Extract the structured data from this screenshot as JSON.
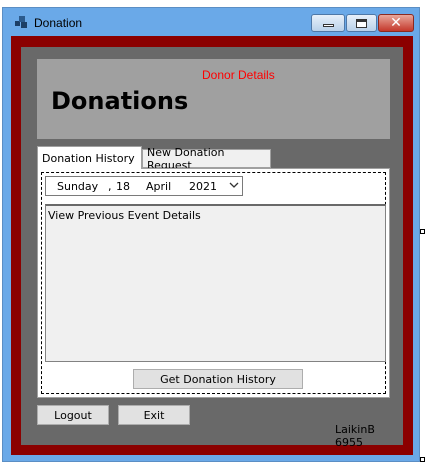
{
  "window": {
    "title": "Donation"
  },
  "header": {
    "subtitle": "Donor Details",
    "title": "Donations"
  },
  "tabs": [
    {
      "label": "Donation History",
      "active": true
    },
    {
      "label": "New Donation Request",
      "active": false
    }
  ],
  "date_picker": {
    "day_name": "Sunday",
    "separator": ",",
    "day": "18",
    "month": "April",
    "year": "2021"
  },
  "details": {
    "text": "View Previous Event Details"
  },
  "buttons": {
    "get_history": "Get Donation History",
    "logout": "Logout",
    "exit": "Exit"
  },
  "footer": {
    "text": "LaikinB 6955"
  },
  "colors": {
    "frame": "#8b0000",
    "panel": "#696969",
    "header": "#a0a0a0",
    "accent_text": "#ff0000"
  },
  "icons": {
    "app": "app-windows-icon",
    "minimize": "minimize-icon",
    "maximize": "maximize-icon",
    "close": "close-icon",
    "dropdown": "chevron-down-icon"
  }
}
